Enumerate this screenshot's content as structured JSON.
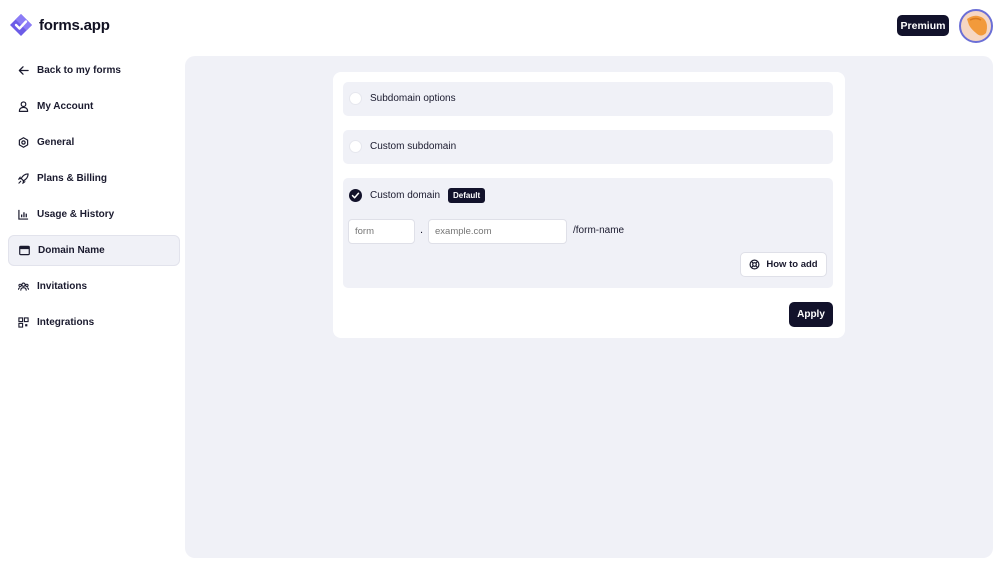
{
  "app": {
    "logo_text": "forms.app",
    "premium_label": "Premium"
  },
  "sidebar": {
    "items": [
      {
        "label": "Back to my forms",
        "icon": "arrow-left-icon"
      },
      {
        "label": "My Account",
        "icon": "user-icon"
      },
      {
        "label": "General",
        "icon": "gear-icon"
      },
      {
        "label": "Plans & Billing",
        "icon": "rocket-icon"
      },
      {
        "label": "Usage & History",
        "icon": "bar-chart-icon"
      },
      {
        "label": "Domain Name",
        "icon": "browser-window-icon",
        "active": true
      },
      {
        "label": "Invitations",
        "icon": "users-icon"
      },
      {
        "label": "Integrations",
        "icon": "grid-icon"
      }
    ]
  },
  "domain": {
    "options": [
      {
        "label": "Subdomain options",
        "selected": false
      },
      {
        "label": "Custom subdomain",
        "selected": false
      },
      {
        "label": "Custom domain",
        "selected": true,
        "badge": "Default"
      }
    ],
    "subdomain_placeholder": "form",
    "domain_placeholder": "example.com",
    "separator": ".",
    "path_suffix": "/form-name",
    "how_to_add_label": "How to add",
    "apply_label": "Apply"
  },
  "colors": {
    "accent": "#12122b",
    "panel_bg": "#f0f1f7",
    "logo_purple": "#6c5ce7"
  }
}
